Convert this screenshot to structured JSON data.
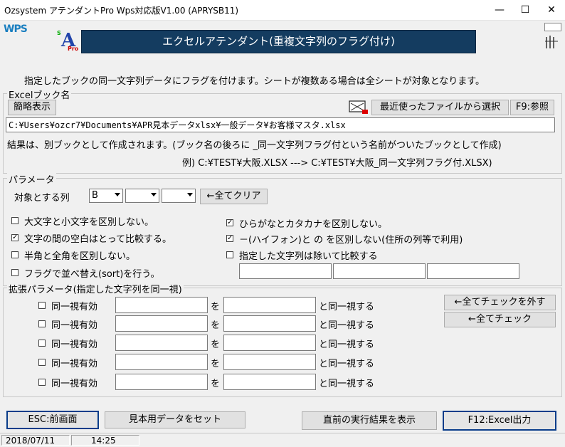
{
  "window": {
    "title": "Ozsystem アテンダントPro Wps対応版V1.00 (APRYSB11)",
    "minimize": "—",
    "maximize": "☐",
    "close": "✕"
  },
  "logo": {
    "wps": "WPS",
    "s": "S",
    "a": "A",
    "pro": "Pro"
  },
  "banner": "エクセルアテンダント(重複文字列のフラグ付け)",
  "description": "指定したブックの同一文字列データにフラグを付けます。シートが複数ある場合は全シートが対象となります。",
  "excel": {
    "group_label": "Excelブック名",
    "compact_button": "簡略表示",
    "recent_button": "最近使ったファイルから選択",
    "browse_button": "F9:参照",
    "path": "C:¥Users¥ozcr7¥Documents¥APR見本データxlsx¥一般データ¥お客様マスタ.xlsx",
    "note1": "結果は、別ブックとして作成されます。(ブック名の後ろに _同一文字列フラグ付という名前がついたブックとして作成)",
    "note2": "例)  C:¥TEST¥大阪.XLSX ---> C:¥TEST¥大阪_同一文字列フラグ付.XLSX)"
  },
  "params": {
    "group_label": "パラメータ",
    "target_col_label": "対象とする列",
    "col1": "B",
    "col2": "",
    "col3": "",
    "clear_all": "←全てクリア",
    "options": [
      {
        "label": "大文字と小文字を区別しない。",
        "checked": false
      },
      {
        "label": "文字の間の空白はとって比較する。",
        "checked": true
      },
      {
        "label": "半角と全角を区別しない。",
        "checked": false
      },
      {
        "label": "フラグで並べ替え(sort)を行う。",
        "checked": false
      },
      {
        "label": "ひらがなとカタカナを区別しない。",
        "checked": true
      },
      {
        "label": "－(ハイフォン)と の を区別しない(住所の列等で利用)",
        "checked": true
      },
      {
        "label": "指定した文字列は除いて比較する",
        "checked": false
      }
    ]
  },
  "extended": {
    "group_label": "拡張パラメータ(指定した文字列を同一視)",
    "uncheck_all": "←全てチェックを外す",
    "check_all": "←全てチェック",
    "rows": [
      {
        "label": "同一視有効",
        "wo": "を",
        "same": "と同一視する"
      },
      {
        "label": "同一視有効",
        "wo": "を",
        "same": "と同一視する"
      },
      {
        "label": "同一視有効",
        "wo": "を",
        "same": "と同一視する"
      },
      {
        "label": "同一視有効",
        "wo": "を",
        "same": "と同一視する"
      },
      {
        "label": "同一視有効",
        "wo": "を",
        "same": "と同一視する"
      }
    ]
  },
  "footer": {
    "esc": "ESC:前画面",
    "sample": "見本用データをセット",
    "last_result": "直前の実行結果を表示",
    "excel_out": "F12:Excel出力"
  },
  "status": {
    "date": "2018/07/11",
    "time": "14:25"
  }
}
